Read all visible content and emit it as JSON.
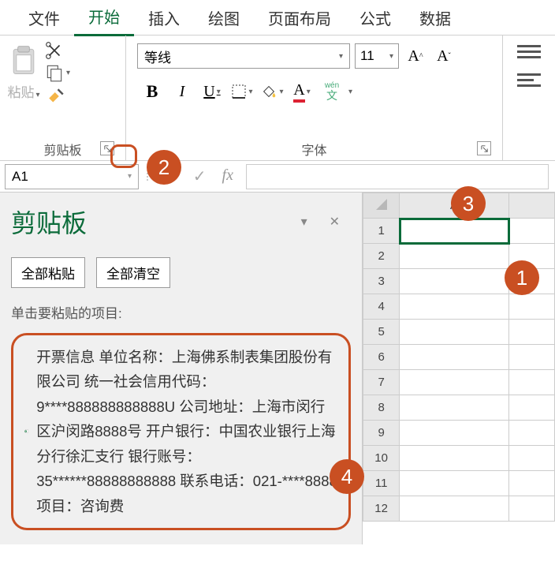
{
  "tabs": [
    "文件",
    "开始",
    "插入",
    "绘图",
    "页面布局",
    "公式",
    "数据"
  ],
  "activeTab": 1,
  "ribbon": {
    "clipboard": {
      "label": "剪贴板",
      "paste": "粘贴"
    },
    "font": {
      "label": "字体",
      "name": "等线",
      "size": "11",
      "buttons": {
        "bold": "B",
        "italic": "I",
        "underline": "U"
      },
      "wen": "wén",
      "wen2": "文"
    }
  },
  "formula_bar": {
    "cell_ref": "A1",
    "fx": "fx"
  },
  "pane": {
    "title": "剪贴板",
    "paste_all": "全部粘贴",
    "clear_all": "全部清空",
    "hint": "单击要粘贴的项目:",
    "item_text": "开票信息 单位名称：上海佛系制表集团股份有限公司 统一社会信用代码：9****888888888888U 公司地址：上海市闵行区沪闵路8888号 开户银行：中国农业银行上海分行徐汇支行 银行账号：35******88888888888 联系电话：021-****8888 项目：咨询费"
  },
  "sheet": {
    "col": "A",
    "rows": 12
  },
  "callouts": {
    "c1": "1",
    "c2": "2",
    "c3": "3",
    "c4": "4"
  }
}
